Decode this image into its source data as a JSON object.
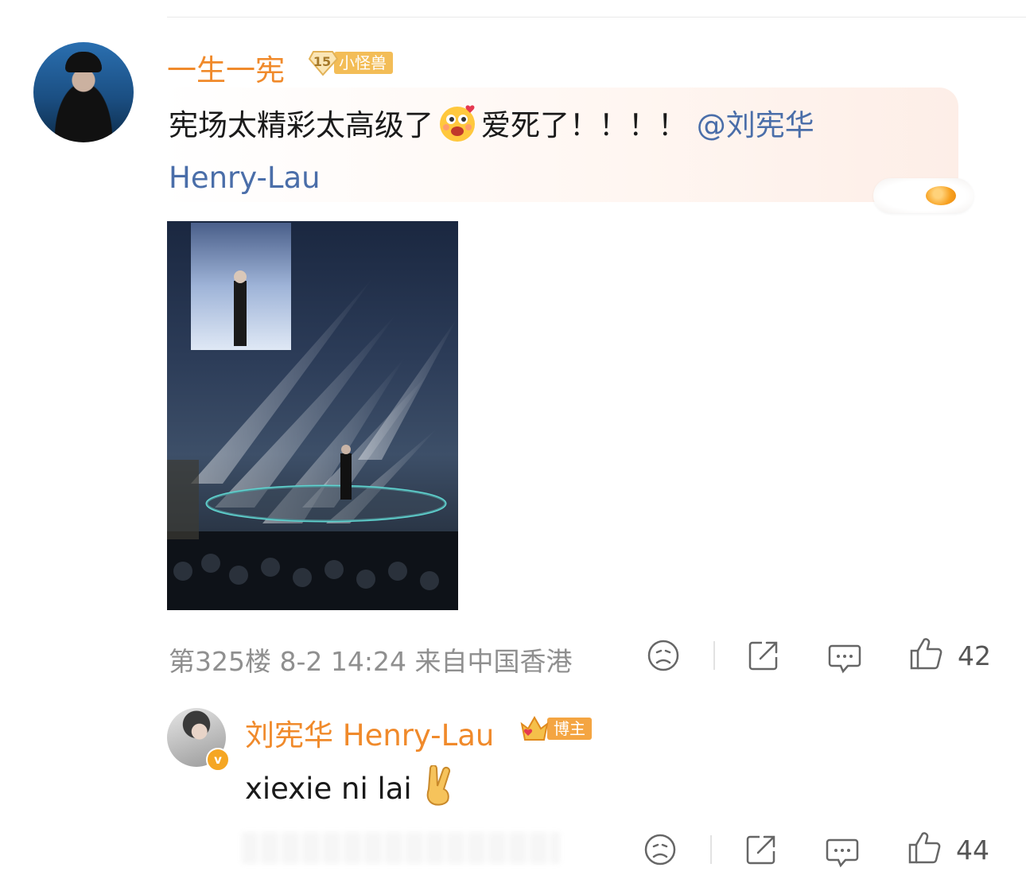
{
  "comment": {
    "username": "一生一宪",
    "level_number": "15",
    "level_label": "小怪兽",
    "text_before": "宪场太精彩太高级了",
    "text_after": "爱死了！！！！",
    "mention": "@刘宪华 Henry-Lau",
    "floor": "第325楼",
    "date": "8-2 14:24",
    "location": "来自中国香港",
    "likes": "42"
  },
  "reply": {
    "username": "刘宪华 Henry-Lau",
    "host_label": "博主",
    "text": "xiexie ni lai",
    "likes": "44"
  },
  "icons": {
    "dislike": "sad-face-icon",
    "share": "share-icon",
    "comment": "comment-icon",
    "like": "thumbs-up-icon",
    "verified": "verified-v-icon",
    "emoji1": "blushing-emoji-icon",
    "emoji2": "victory-hand-emoji-icon"
  },
  "colors": {
    "username": "#f08a2b",
    "mention": "#4a6ea9",
    "meta": "#8f8f8f",
    "level_badge": "#f3bd57",
    "host_badge": "#f4a542"
  }
}
